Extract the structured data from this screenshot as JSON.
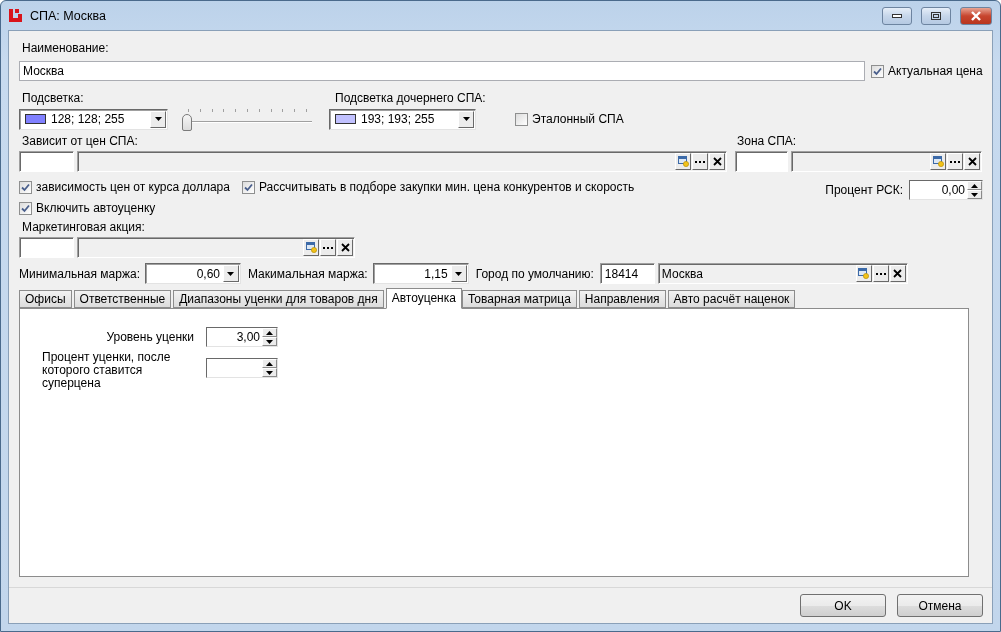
{
  "window": {
    "title": "СПА: Москва"
  },
  "name": {
    "label": "Наименование:",
    "value": "Москва"
  },
  "actual_price": {
    "label": "Актуальная цена",
    "checked": true
  },
  "highlight": {
    "label": "Подсветка:",
    "value": "128; 128; 255",
    "color": "#8080ff"
  },
  "highlight_slider": {
    "level": 0
  },
  "child_highlight": {
    "label": "Подсветка дочернего СПА:",
    "value": "193; 193; 255",
    "color": "#c1c1ff"
  },
  "reference_spa": {
    "label": "Эталонный СПА",
    "checked": false
  },
  "depends_on": {
    "label": "Зависит от цен СПА:"
  },
  "zone": {
    "label": "Зона СПА:"
  },
  "dollar_dependency": {
    "label": "зависимость цен от курса доллара",
    "checked": true
  },
  "competitor_price": {
    "label": "Рассчитывать в подборе закупки мин. цена конкурентов и скорость",
    "checked": true
  },
  "rsk_percent": {
    "label": "Процент РСК:",
    "value": "0,00"
  },
  "auto_markdown": {
    "label": "Включить автоуценку",
    "checked": true
  },
  "marketing": {
    "label": "Маркетинговая акция:"
  },
  "min_margin": {
    "label": "Минимальная маржа:",
    "value": "0,60"
  },
  "max_margin": {
    "label": "Макимальная маржа:",
    "value": "1,15"
  },
  "default_city": {
    "label": "Город по умолчанию:",
    "code": "18414",
    "value": "Москва"
  },
  "tabs": [
    {
      "label": "Офисы",
      "selected": false
    },
    {
      "label": "Ответственные",
      "selected": false
    },
    {
      "label": "Диапазоны уценки для товаров дня",
      "selected": false
    },
    {
      "label": "Автоуценка",
      "selected": true
    },
    {
      "label": "Товарная матрица",
      "selected": false
    },
    {
      "label": "Направления",
      "selected": false
    },
    {
      "label": "Авто расчёт наценок",
      "selected": false
    }
  ],
  "tab_panel": {
    "fields": [
      {
        "label": "Уровень уценки",
        "value": "3,00"
      },
      {
        "label": "Процент уценки, после которого ставится суперцена"
      }
    ]
  },
  "buttons": [
    {
      "label": "OK"
    },
    {
      "label": "Отмена"
    }
  ]
}
